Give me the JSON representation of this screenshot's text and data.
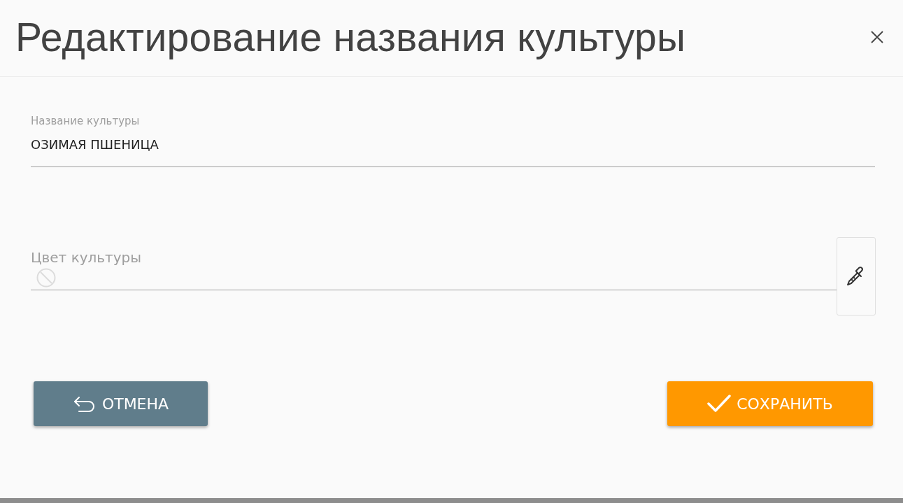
{
  "dialog": {
    "title": "Редактирование названия культуры"
  },
  "name_field": {
    "label": "Название культуры",
    "value": "ОЗИМАЯ ПШЕНИЦА"
  },
  "color_field": {
    "placeholder": "Цвет культуры",
    "no_color": true
  },
  "buttons": [
    {
      "kind": "cancel",
      "label": "ОТМЕНА"
    },
    {
      "kind": "save",
      "label": "СОХРАНИТЬ"
    }
  ]
}
